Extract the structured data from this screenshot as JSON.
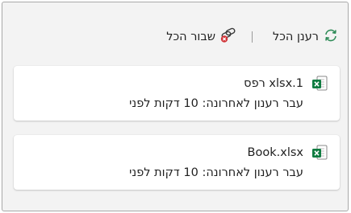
{
  "toolbar": {
    "refresh_all_label": "רענן הכל",
    "break_all_label": "שבור הכל",
    "refresh_icon": "refresh-icon",
    "break_icon": "unlink-icon"
  },
  "files": [
    {
      "name": "ספר xlsx.1",
      "status": "עבר רענון לאחרונה: 10 דקות לפני",
      "icon": "excel-file-icon"
    },
    {
      "name": "Book.xlsx",
      "status": "עבר רענון לאחרונה: 10 דקות לפני",
      "icon": "excel-file-icon"
    }
  ],
  "colors": {
    "excel_green": "#107c41",
    "refresh_green": "#2e8b57",
    "break_red": "#d13438"
  }
}
